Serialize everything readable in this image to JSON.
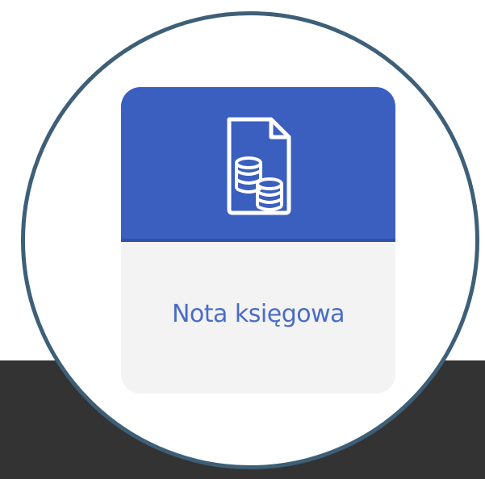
{
  "tile": {
    "label": "Nota księgowa",
    "icon": "document-coins-icon",
    "colors": {
      "header": "#3b5fbf",
      "body": "#f3f3f3",
      "label": "#4a6cc6",
      "ring": "#3e5f78",
      "background_band": "#333333"
    }
  }
}
